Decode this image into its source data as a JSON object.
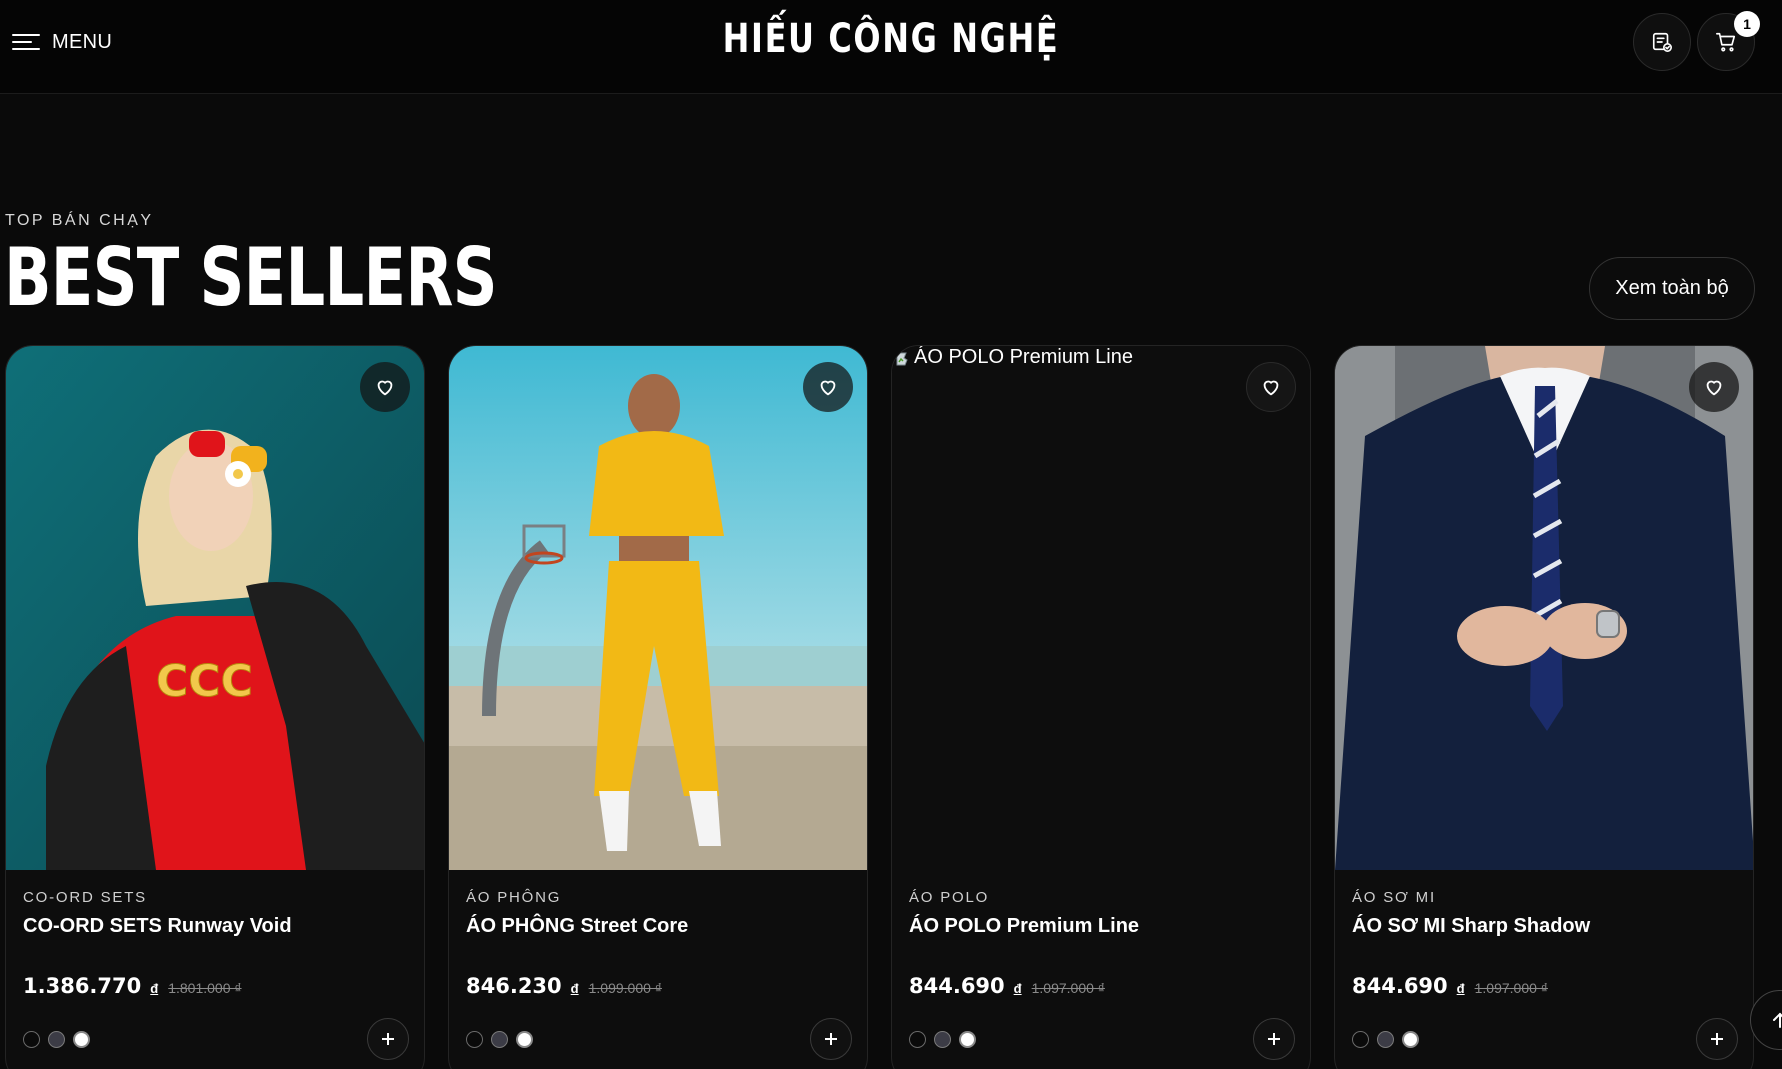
{
  "header": {
    "menu_label": "MENU",
    "logo": "HIẾU CÔNG NGHỆ",
    "cart_count": "1"
  },
  "section": {
    "eyebrow": "TOP BÁN CHẠY",
    "title": "BEST SELLERS",
    "view_all": "Xem toàn bộ"
  },
  "products": [
    {
      "category": "CO-ORD SETS",
      "name": "CO-ORD SETS Runway Void",
      "price": "1.386.770",
      "currency": "đ",
      "old_price": "1.801.000 ₫",
      "image_alt": "",
      "swatches": [
        "#0a0a0a",
        "#3c3c46",
        "#ffffff"
      ]
    },
    {
      "category": "ÁO PHÔNG",
      "name": "ÁO PHÔNG Street Core",
      "price": "846.230",
      "currency": "đ",
      "old_price": "1.099.000 ₫",
      "image_alt": "",
      "swatches": [
        "#0a0a0a",
        "#3c3c46",
        "#ffffff"
      ]
    },
    {
      "category": "ÁO POLO",
      "name": "ÁO POLO Premium Line",
      "price": "844.690",
      "currency": "đ",
      "old_price": "1.097.000 ₫",
      "image_alt": "ÁO POLO Premium Line",
      "swatches": [
        "#0a0a0a",
        "#3c3c46",
        "#ffffff"
      ]
    },
    {
      "category": "ÁO SƠ MI",
      "name": "ÁO SƠ MI Sharp Shadow",
      "price": "844.690",
      "currency": "đ",
      "old_price": "1.097.000 ₫",
      "image_alt": "",
      "swatches": [
        "#0a0a0a",
        "#3c3c46",
        "#ffffff"
      ]
    }
  ],
  "icons": {
    "menu": "hamburger-menu-icon",
    "orders": "order-list-icon",
    "cart": "shopping-cart-icon",
    "favorite": "heart-outline-icon",
    "add": "plus-icon",
    "scroll_top": "arrow-up-icon"
  },
  "colors": {
    "background": "#0a0a0a",
    "card": "#0d0d0d",
    "text": "#ffffff",
    "muted": "#8a8a8a"
  }
}
